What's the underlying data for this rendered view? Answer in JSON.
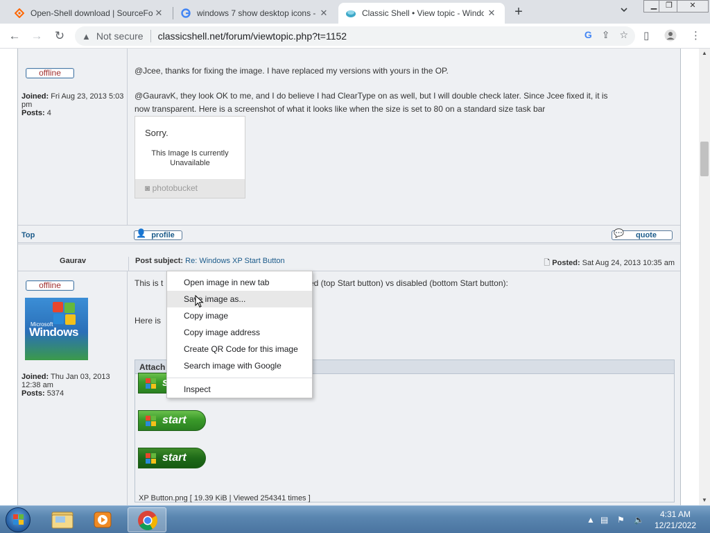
{
  "browser": {
    "tabs": [
      {
        "title": "Open-Shell download | SourceFo",
        "active": false
      },
      {
        "title": "windows 7 show desktop icons -",
        "active": false
      },
      {
        "title": "Classic Shell • View topic - Windo",
        "active": true
      }
    ],
    "new_tab": "+",
    "security_label": "Not secure",
    "url": "classicshell.net/forum/viewtopic.php?t=1152"
  },
  "posts": [
    {
      "status": "offline",
      "joined_label": "Joined:",
      "joined": "Fri Aug 23, 2013 5:03 pm",
      "posts_label": "Posts:",
      "posts": "4",
      "paragraphs": [
        "@Jcee, thanks for fixing the image. I have replaced my versions with yours in the OP.",
        "@GauravK, they look OK to me, and I do believe I had ClearType on as well, but I will double check later. Since Jcee fixed it, it is",
        "now transparent. Here is a screenshot of what it looks like when the size is set to 80 on a standard size task bar"
      ],
      "image": {
        "sorry": "Sorry.",
        "line1": "This Image Is currently",
        "line2": "Unavailable",
        "brand": "photobucket"
      },
      "top_link": "Top",
      "profile_label": "profile",
      "quote_label": "quote"
    },
    {
      "author": "Gaurav",
      "subject_label": "Post subject:",
      "subject": "Re: Windows XP Start Button",
      "posted_label": "Posted:",
      "posted": "Sat Aug 24, 2013 10:35 am",
      "status": "offline",
      "avatar_brand_small": "Microsoft",
      "avatar_brand": "Windows",
      "joined_label": "Joined:",
      "joined": "Thu Jan 03, 2013 12:38 am",
      "posts_label": "Posts:",
      "posts": "5374",
      "text1_start": "This is t",
      "text1_end": "ed (top Start button) vs disabled (bottom Start button):",
      "text2_start": "Here is",
      "attach_header": "Attach",
      "start_label": "start",
      "file_info": "XP Button.png [ 19.39 KiB | Viewed 254341 times ]"
    }
  ],
  "context_menu": {
    "items": [
      "Open image in new tab",
      "Save image as...",
      "Copy image",
      "Copy image address",
      "Create QR Code for this image",
      "Search image with Google",
      "Inspect"
    ],
    "highlighted": "Save image as..."
  },
  "taskbar": {
    "time": "4:31 AM",
    "date": "12/21/2022"
  },
  "colors": {
    "link": "#1a5a8a",
    "offline": "#a03030",
    "forum_bg": "#eef0f3",
    "taskbar": "#5a86b0"
  }
}
